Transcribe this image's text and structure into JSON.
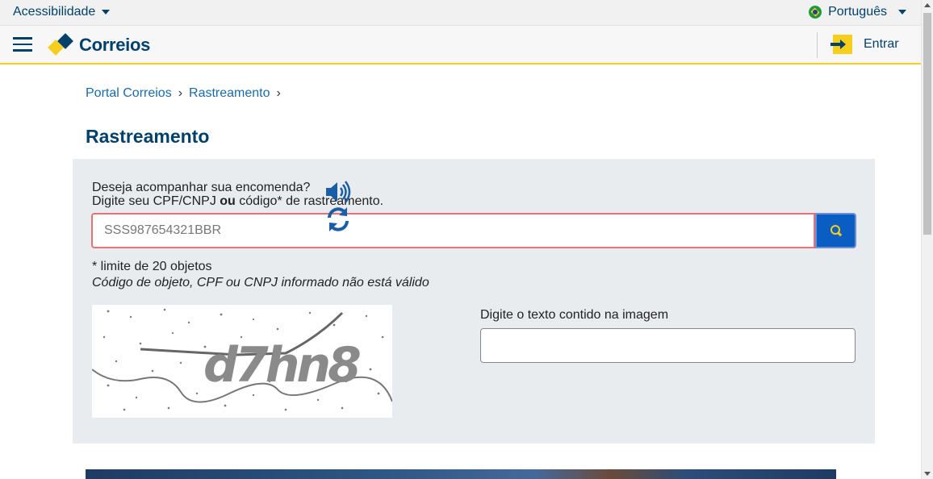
{
  "topbar": {
    "accessibility_label": "Acessibilidade",
    "language_label": "Português"
  },
  "header": {
    "logo_text": "Correios",
    "login_label": "Entrar"
  },
  "breadcrumb": {
    "items": [
      "Portal Correios",
      "Rastreamento"
    ]
  },
  "page": {
    "title": "Rastreamento"
  },
  "tracking": {
    "intro_line1": "Deseja acompanhar sua encomenda?",
    "intro_line2_pre": "Digite seu CPF/CNPJ ",
    "intro_line2_bold": "ou",
    "intro_line2_post": " código* de rastreamento.",
    "input_value": "SSS987654321BBR",
    "limit_note": "* limite de 20 objetos",
    "error_message": "Código de objeto, CPF ou CNPJ informado não está válido"
  },
  "captcha": {
    "image_text": "d7hn8",
    "input_label": "Digite o texto contido na imagem",
    "input_value": ""
  },
  "colors": {
    "brand_blue": "#00416b",
    "brand_yellow": "#f5cf1c",
    "link_blue": "#1a6ba8",
    "button_blue": "#0a5dc2",
    "error_border": "#e57373",
    "panel_bg": "#e9ecef"
  }
}
